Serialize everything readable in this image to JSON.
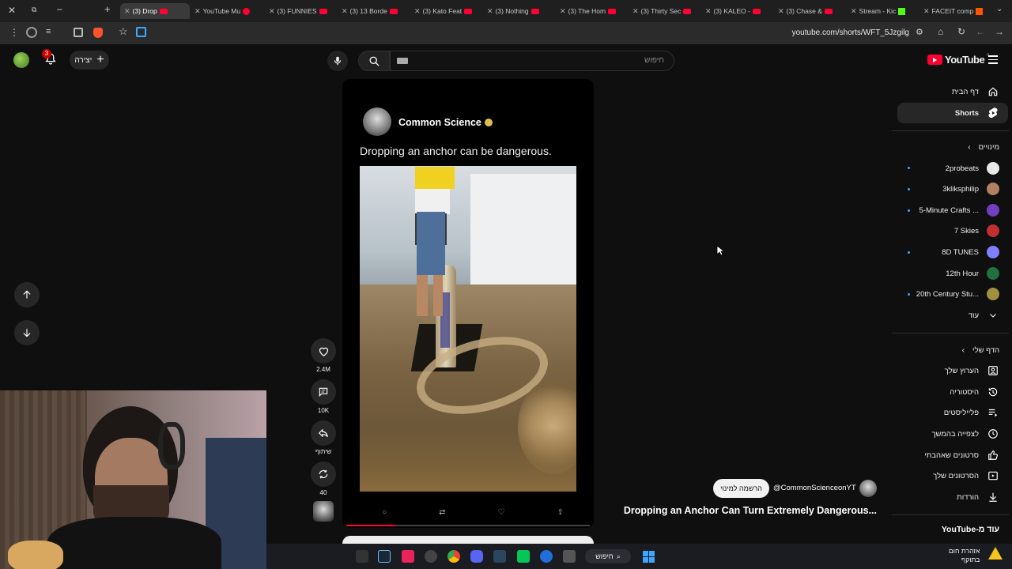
{
  "browser": {
    "tabs": [
      {
        "label": "(3) Drop"
      },
      {
        "label": "YouTube Mu"
      },
      {
        "label": "(3) FUNNIES"
      },
      {
        "label": "(3) 13 Borde"
      },
      {
        "label": "(3) Kato Feat"
      },
      {
        "label": "(3) Nothing"
      },
      {
        "label": "(3) The Hom"
      },
      {
        "label": "(3) Thirty Sec"
      },
      {
        "label": "(3) KALEO -"
      },
      {
        "label": "(3) Chase &"
      },
      {
        "label": "Stream - Kic"
      },
      {
        "label": "FACEIT comp"
      }
    ],
    "url": "youtube.com/shorts/WFT_5Jzgilg"
  },
  "header": {
    "logo_text": "YouTube",
    "logo_sup": "IL",
    "search_placeholder": "חיפוש",
    "create_label": "יצירה",
    "notif_count": "3"
  },
  "sidebar": {
    "home": "דף הבית",
    "shorts": "Shorts",
    "subs_title": "מינויים",
    "subs": [
      {
        "name": "2probeats",
        "dot": true,
        "color": "#e8e8e8"
      },
      {
        "name": "3kliksphilip",
        "dot": true,
        "color": "#b08060"
      },
      {
        "name": "5-Minute Crafts ...",
        "dot": true,
        "color": "#7040c0"
      },
      {
        "name": "7 Skies",
        "dot": false,
        "color": "#c03030"
      },
      {
        "name": "8D TUNES",
        "dot": true,
        "color": "#8080ff"
      },
      {
        "name": "12th Hour",
        "dot": false,
        "color": "#207040"
      },
      {
        "name": "20th Century Stu...",
        "dot": true,
        "color": "#a09040"
      }
    ],
    "more": "עוד",
    "you_title": "הדף שלי",
    "you_items": [
      {
        "label": "הערוץ שלך",
        "icon": "channel-icon"
      },
      {
        "label": "היסטוריה",
        "icon": "history-icon"
      },
      {
        "label": "פלייליסטים",
        "icon": "playlist-icon"
      },
      {
        "label": "לצפייה בהמשך",
        "icon": "watch-later-icon"
      },
      {
        "label": "סרטונים שאהבתי",
        "icon": "like-icon"
      },
      {
        "label": "הסרטונים שלך",
        "icon": "your-videos-icon"
      },
      {
        "label": "הורדות",
        "icon": "download-icon"
      }
    ],
    "more_from": "עוד מ-YouTube"
  },
  "short": {
    "channel_name": "Common Science",
    "caption": "Dropping an anchor can be dangerous.",
    "handle": "@CommonScienceonYT",
    "subscribe_label": "הרשמה למינוי",
    "title": "Dropping an Anchor Can Turn Extremely Dangerous...",
    "likes": "2.4M",
    "comments": "10K",
    "share_label": "שיתוף",
    "remix_count": "40"
  },
  "taskbar": {
    "search_label": "חיפוש",
    "weather_line1": "אזהרת חום",
    "weather_line2": "בתוקף"
  }
}
